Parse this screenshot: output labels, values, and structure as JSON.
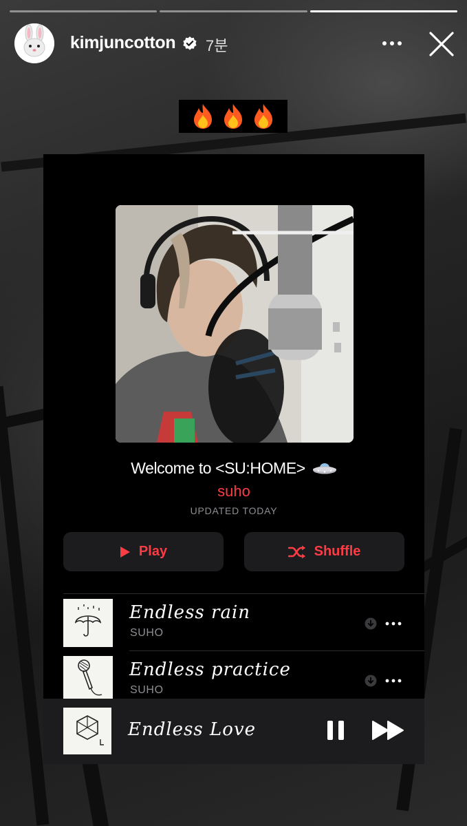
{
  "story": {
    "username": "kimjuncotton",
    "time_ago": "7분",
    "progress_segments": 3,
    "active_segment": 3,
    "sticker": "🔥🔥🔥"
  },
  "playlist": {
    "title": "Welcome to <SU:HOME>",
    "title_emoji_icon": "ufo-icon",
    "artist": "suho",
    "updated": "UPDATED TODAY",
    "play_label": "Play",
    "shuffle_label": "Shuffle",
    "tracks": [
      {
        "title": "Endless rain",
        "artist": "SUHO",
        "art_icon": "umbrella-icon"
      },
      {
        "title": "Endless practice",
        "artist": "SUHO",
        "art_icon": "microphone-icon"
      }
    ],
    "now_playing": {
      "title": "Endless Love",
      "art_icon": "exo-logo-icon"
    }
  },
  "colors": {
    "accent": "#fc3c44",
    "card_bg": "#000000",
    "button_bg": "#1c1c1e",
    "secondary_text": "#8e8e93"
  }
}
